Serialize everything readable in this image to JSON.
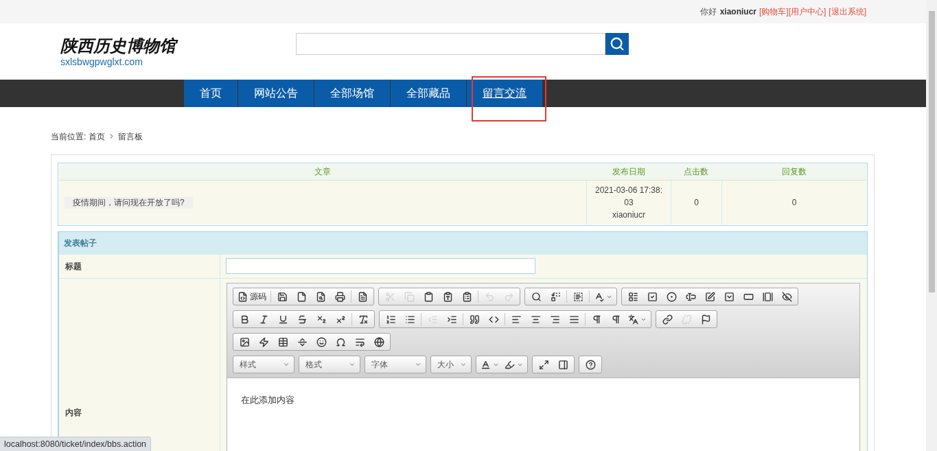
{
  "top_bar": {
    "greeting": "你好",
    "username": "xiaoniucr",
    "links": [
      "[购物车]",
      "[用户中心]",
      "[退出系统]"
    ]
  },
  "header": {
    "logo_text": "陕西历史博物馆",
    "logo_url": "sxlsbwgpwglxt.com"
  },
  "nav": [
    {
      "label": "首页",
      "selected": false
    },
    {
      "label": "网站公告",
      "selected": false
    },
    {
      "label": "全部场馆",
      "selected": false
    },
    {
      "label": "全部藏品",
      "selected": false
    },
    {
      "label": "留言交流",
      "selected": true
    }
  ],
  "breadcrumb": {
    "prefix": "当前位置:",
    "items": [
      "首页",
      "留言板"
    ]
  },
  "posts": {
    "columns": [
      "文章",
      "发布日期",
      "点击数",
      "回复数"
    ],
    "rows": [
      {
        "title": "疫情期间，请问现在开放了吗?",
        "date": "2021-03-06 17:38:03",
        "author": "xiaoniucr",
        "clicks": "0",
        "replies": "0"
      }
    ]
  },
  "form": {
    "title": "发表帖子",
    "title_label": "标题",
    "content_label": "内容",
    "editor": {
      "body": "在此添加内容",
      "rows": [
        {
          "groups": [
            {
              "items": [
                {
                  "kind": "source",
                  "label": "源码",
                  "disabled": false
                },
                {
                  "kind": "separator"
                },
                {
                  "kind": "save",
                  "disabled": false
                },
                {
                  "kind": "newpage",
                  "disabled": false
                },
                {
                  "kind": "preview",
                  "disabled": false
                },
                {
                  "kind": "print",
                  "disabled": false
                },
                {
                  "kind": "separator"
                },
                {
                  "kind": "templates",
                  "disabled": false
                }
              ]
            },
            {
              "items": [
                {
                  "kind": "cut",
                  "disabled": true
                },
                {
                  "kind": "copy",
                  "disabled": true
                },
                {
                  "kind": "paste",
                  "disabled": false
                },
                {
                  "kind": "pastetext",
                  "disabled": false
                },
                {
                  "kind": "pasteword",
                  "disabled": false
                },
                {
                  "kind": "separator"
                },
                {
                  "kind": "undo",
                  "disabled": true
                },
                {
                  "kind": "redo",
                  "disabled": true
                }
              ]
            },
            {
              "items": [
                {
                  "kind": "find",
                  "disabled": false
                },
                {
                  "kind": "replace",
                  "disabled": false
                },
                {
                  "kind": "separator"
                },
                {
                  "kind": "selectall",
                  "disabled": false
                },
                {
                  "kind": "separator"
                },
                {
                  "kind": "spellcheck",
                  "disabled": false
                }
              ]
            },
            {
              "items": [
                {
                  "kind": "form",
                  "disabled": false
                },
                {
                  "kind": "checkbox",
                  "disabled": false
                },
                {
                  "kind": "radio",
                  "disabled": false
                },
                {
                  "kind": "textfield",
                  "disabled": false
                },
                {
                  "kind": "textarea",
                  "disabled": false
                },
                {
                  "kind": "select",
                  "disabled": false
                },
                {
                  "kind": "button",
                  "disabled": false
                },
                {
                  "kind": "imagebutton",
                  "disabled": false
                },
                {
                  "kind": "hiddenfield",
                  "disabled": false
                }
              ]
            }
          ]
        },
        {
          "groups": [
            {
              "items": [
                {
                  "kind": "bold",
                  "disabled": false
                },
                {
                  "kind": "italic",
                  "disabled": false
                },
                {
                  "kind": "underline",
                  "disabled": false
                },
                {
                  "kind": "strike",
                  "disabled": false
                },
                {
                  "kind": "subscript",
                  "disabled": false
                },
                {
                  "kind": "superscript",
                  "disabled": false
                },
                {
                  "kind": "separator"
                },
                {
                  "kind": "removeformat",
                  "disabled": false
                }
              ]
            },
            {
              "items": [
                {
                  "kind": "numberedlist",
                  "disabled": false
                },
                {
                  "kind": "bulletedlist",
                  "disabled": false
                },
                {
                  "kind": "separator"
                },
                {
                  "kind": "outdent",
                  "disabled": true
                },
                {
                  "kind": "indent",
                  "disabled": false
                },
                {
                  "kind": "separator"
                },
                {
                  "kind": "blockquote",
                  "disabled": false
                },
                {
                  "kind": "creatediv",
                  "disabled": false
                },
                {
                  "kind": "separator"
                },
                {
                  "kind": "alignleft",
                  "disabled": false
                },
                {
                  "kind": "aligncenter",
                  "disabled": false
                },
                {
                  "kind": "alignright",
                  "disabled": false
                },
                {
                  "kind": "alignjustify",
                  "disabled": false
                },
                {
                  "kind": "separator"
                },
                {
                  "kind": "bidiltr",
                  "disabled": false
                },
                {
                  "kind": "bidirtl",
                  "disabled": false
                },
                {
                  "kind": "language",
                  "disabled": false
                }
              ]
            },
            {
              "items": [
                {
                  "kind": "link",
                  "disabled": false
                },
                {
                  "kind": "unlink",
                  "disabled": true
                },
                {
                  "kind": "anchor",
                  "disabled": false
                }
              ]
            }
          ]
        },
        {
          "groups": [
            {
              "items": [
                {
                  "kind": "image",
                  "disabled": false
                },
                {
                  "kind": "flash",
                  "disabled": false
                },
                {
                  "kind": "table",
                  "disabled": false
                },
                {
                  "kind": "hr",
                  "disabled": false
                },
                {
                  "kind": "smiley",
                  "disabled": false
                },
                {
                  "kind": "specialchar",
                  "disabled": false
                },
                {
                  "kind": "pagebreak",
                  "disabled": false
                },
                {
                  "kind": "iframe",
                  "disabled": false
                }
              ]
            }
          ]
        }
      ],
      "combos": [
        {
          "label": "样式",
          "wide": true
        },
        {
          "label": "格式",
          "wide": true
        },
        {
          "label": "字体",
          "wide": true
        },
        {
          "label": "大小",
          "wide": false
        }
      ],
      "tail_groups": [
        {
          "items": [
            {
              "kind": "textcolor",
              "disabled": false
            },
            {
              "kind": "bgcolor",
              "disabled": false
            }
          ]
        },
        {
          "items": [
            {
              "kind": "maximize",
              "disabled": false
            },
            {
              "kind": "showblocks",
              "disabled": false
            }
          ]
        },
        {
          "items": [
            {
              "kind": "about",
              "disabled": false
            }
          ]
        }
      ]
    }
  },
  "status_url": "localhost:8080/ticket/index/bbs.action"
}
